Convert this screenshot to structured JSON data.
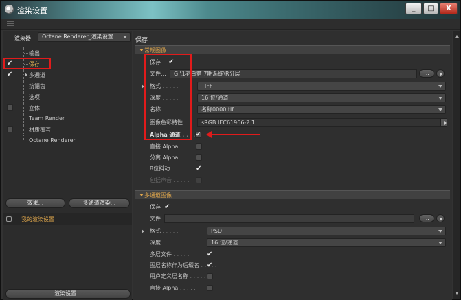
{
  "window": {
    "title": "渲染设置",
    "btn_min": "_",
    "btn_max": "□",
    "btn_close": "X"
  },
  "left": {
    "renderer_label": "渲染器",
    "renderer_value": "Octane Renderer_渲染设置",
    "tree": [
      {
        "label": "输出",
        "check": "none",
        "active": false,
        "arrow": false
      },
      {
        "label": "保存",
        "check": "tick",
        "active": true,
        "arrow": false
      },
      {
        "label": "多通道",
        "check": "tick",
        "active": false,
        "arrow": true
      },
      {
        "label": "抗锯齿",
        "check": "none",
        "active": false,
        "arrow": false
      },
      {
        "label": "选项",
        "check": "none",
        "active": false,
        "arrow": false
      },
      {
        "label": "立体",
        "check": "box",
        "active": false,
        "arrow": false
      },
      {
        "label": "Team Render",
        "check": "none",
        "active": false,
        "arrow": false
      },
      {
        "label": "材质覆写",
        "check": "box",
        "active": false,
        "arrow": false
      },
      {
        "label": "Octane Renderer",
        "check": "none",
        "active": false,
        "arrow": false
      }
    ],
    "effects_button": "效果...",
    "multipass_button": "多通道渲染...",
    "preset_label": "我的渲染设置",
    "render_settings_button": "渲染设置..."
  },
  "right": {
    "title": "保存",
    "regular": {
      "header": "常规图像",
      "save_label": "保存",
      "file_label": "文件...",
      "file_value": "G:\\1老白第 7期渐练\\R分层",
      "file_btn": "...",
      "format_label": "格式",
      "format_value": "TIFF",
      "depth_label": "深度",
      "depth_value": "16 位/通道",
      "name_label": "名称",
      "name_value": "名称0000.tif",
      "profile_label": "图像色彩特性",
      "profile_value": "sRGB IEC61966-2.1",
      "alpha_label": "Alpha 通道",
      "straight_alpha_label": "直接 Alpha",
      "separate_alpha_label": "分离 Alpha",
      "dither_label": "8位抖动",
      "include_sound_label": "包括声音"
    },
    "multipass": {
      "header": "多通道图像",
      "save_label": "保存",
      "file_label": "文件",
      "file_value": "",
      "file_btn": "...",
      "format_label": "格式",
      "format_value": "PSD",
      "depth_label": "深度",
      "depth_value": "16 位/通道",
      "layer_file_label": "多层文件",
      "layer_suffix_label": "图层名称作为后缀名",
      "user_layer_label": "用户定义层名称",
      "straight_alpha_label": "直接 Alpha"
    }
  },
  "colors": {
    "highlight": "#e11b1b",
    "accent": "#e2a84c"
  }
}
